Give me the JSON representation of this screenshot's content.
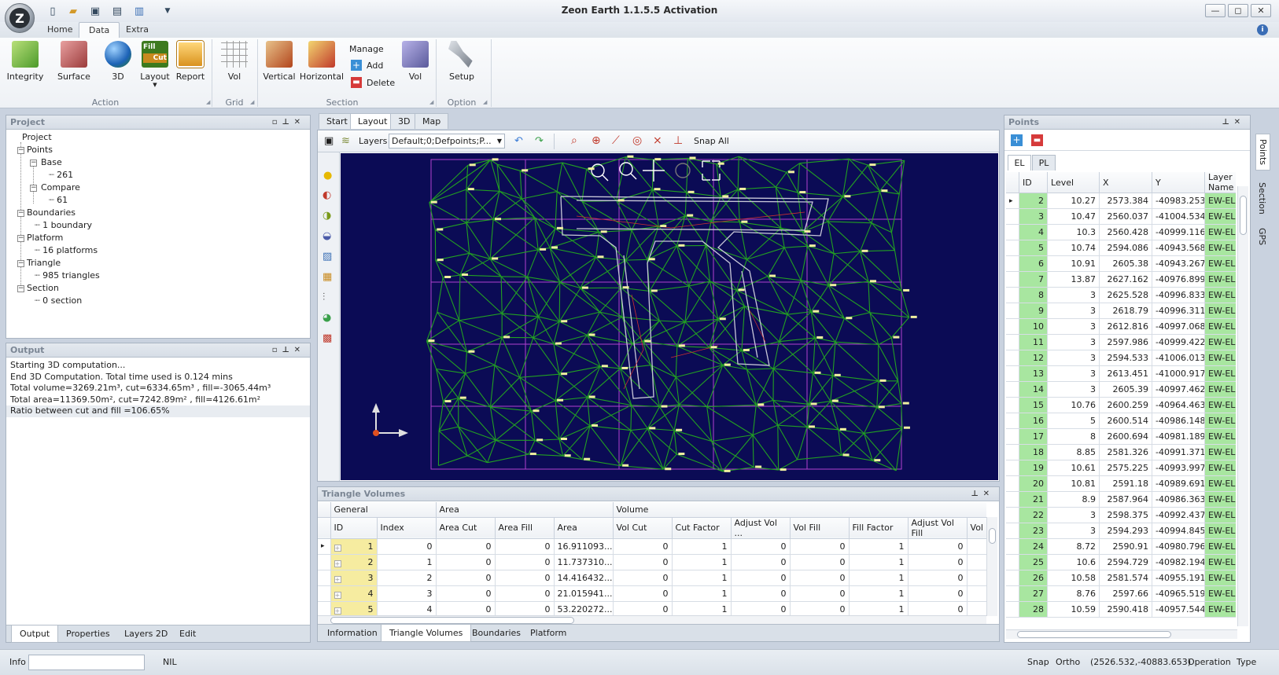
{
  "window": {
    "title": "Zeon Earth 1.1.5.5 Activation"
  },
  "ribbon": {
    "tabs": [
      "Home",
      "Data",
      "Extra"
    ],
    "groups": {
      "action": {
        "label": "Action",
        "buttons": [
          "Integrity",
          "Surface",
          "3D",
          "Layout",
          "Report"
        ],
        "fill_icon": [
          "Fill",
          "Cut"
        ]
      },
      "grid": {
        "label": "Grid",
        "buttons": [
          "Vol"
        ]
      },
      "section": {
        "label": "Section",
        "buttons": [
          "Vertical",
          "Horizontal"
        ],
        "manage": "Manage",
        "add": "Add",
        "delete": "Delete",
        "vol": "Vol"
      },
      "option": {
        "label": "Option",
        "buttons": [
          "Setup"
        ]
      }
    }
  },
  "project": {
    "title": "Project",
    "tree": {
      "root": "Project",
      "points": "Points",
      "base": "Base",
      "base_count": "261",
      "compare": "Compare",
      "compare_count": "61",
      "boundaries": "Boundaries",
      "boundaries_item": "1 boundary",
      "platform": "Platform",
      "platform_item": "16 platforms",
      "triangle": "Triangle",
      "triangle_item": "985 triangles",
      "section": "Section",
      "section_item": "0 section"
    }
  },
  "output": {
    "title": "Output",
    "lines": [
      "Starting 3D computation...",
      "End 3D Computation. Total time used is 0.124 mins",
      "Total volume=3269.21m³, cut=6334.65m³ , fill=-3065.44m³",
      "Total area=11369.50m², cut=7242.89m² , fill=4126.61m²",
      "Ratio between cut and fill =106.65%"
    ]
  },
  "left_tabs": [
    "Output",
    "Properties",
    "Layers 2D",
    "Edit"
  ],
  "doc_tabs": [
    "Start",
    "Layout",
    "3D",
    "Map"
  ],
  "layout_toolbar": {
    "layers_label": "Layers",
    "layers_value": "Default;0;Defpoints;P...",
    "snap_all": "Snap All"
  },
  "triangle_volumes": {
    "title": "Triangle Volumes",
    "band_headers": [
      "General",
      "Area",
      "Volume"
    ],
    "columns": [
      "ID",
      "Index",
      "Area Cut",
      "Area Fill",
      "Area",
      "Vol Cut",
      "Cut Factor",
      "Adjust Vol ...",
      "Vol Fill",
      "Fill Factor",
      "Adjust Vol Fill",
      "Vol"
    ],
    "rows": [
      [
        "1",
        "0",
        "0",
        "0",
        "16.911093...",
        "0",
        "1",
        "0",
        "0",
        "1",
        "0"
      ],
      [
        "2",
        "1",
        "0",
        "0",
        "11.737310...",
        "0",
        "1",
        "0",
        "0",
        "1",
        "0"
      ],
      [
        "3",
        "2",
        "0",
        "0",
        "14.416432...",
        "0",
        "1",
        "0",
        "0",
        "1",
        "0"
      ],
      [
        "4",
        "3",
        "0",
        "0",
        "21.015941...",
        "0",
        "1",
        "0",
        "0",
        "1",
        "0"
      ],
      [
        "5",
        "4",
        "0",
        "0",
        "53.220272...",
        "0",
        "1",
        "0",
        "0",
        "1",
        "0"
      ]
    ]
  },
  "bottom_tabs": [
    "Information",
    "Triangle Volumes",
    "Boundaries",
    "Platform"
  ],
  "points": {
    "title": "Points",
    "subtabs": [
      "EL",
      "PL"
    ],
    "columns": [
      "ID",
      "Level",
      "X",
      "Y",
      "Layer Name"
    ],
    "rows": [
      [
        "2",
        "10.27",
        "2573.384",
        "-40983.253",
        "EW-EL"
      ],
      [
        "3",
        "10.47",
        "2560.037",
        "-41004.534",
        "EW-EL"
      ],
      [
        "4",
        "10.3",
        "2560.428",
        "-40999.116",
        "EW-EL"
      ],
      [
        "5",
        "10.74",
        "2594.086",
        "-40943.568",
        "EW-EL"
      ],
      [
        "6",
        "10.91",
        "2605.38",
        "-40943.267",
        "EW-EL"
      ],
      [
        "7",
        "13.87",
        "2627.162",
        "-40976.899",
        "EW-EL"
      ],
      [
        "8",
        "3",
        "2625.528",
        "-40996.833",
        "EW-EL"
      ],
      [
        "9",
        "3",
        "2618.79",
        "-40996.311",
        "EW-EL"
      ],
      [
        "10",
        "3",
        "2612.816",
        "-40997.068",
        "EW-EL"
      ],
      [
        "11",
        "3",
        "2597.986",
        "-40999.422",
        "EW-EL"
      ],
      [
        "12",
        "3",
        "2594.533",
        "-41006.013",
        "EW-EL"
      ],
      [
        "13",
        "3",
        "2613.451",
        "-41000.917",
        "EW-EL"
      ],
      [
        "14",
        "3",
        "2605.39",
        "-40997.462",
        "EW-EL"
      ],
      [
        "15",
        "10.76",
        "2600.259",
        "-40964.463",
        "EW-EL"
      ],
      [
        "16",
        "5",
        "2600.514",
        "-40986.148",
        "EW-EL"
      ],
      [
        "17",
        "8",
        "2600.694",
        "-40981.189",
        "EW-EL"
      ],
      [
        "18",
        "8.85",
        "2581.326",
        "-40991.371",
        "EW-EL"
      ],
      [
        "19",
        "10.61",
        "2575.225",
        "-40993.997",
        "EW-EL"
      ],
      [
        "20",
        "10.81",
        "2591.18",
        "-40989.691",
        "EW-EL"
      ],
      [
        "21",
        "8.9",
        "2587.964",
        "-40986.363",
        "EW-EL"
      ],
      [
        "22",
        "3",
        "2598.375",
        "-40992.437",
        "EW-EL"
      ],
      [
        "23",
        "3",
        "2594.293",
        "-40994.845",
        "EW-EL"
      ],
      [
        "24",
        "8.72",
        "2590.91",
        "-40980.796",
        "EW-EL"
      ],
      [
        "25",
        "10.6",
        "2594.729",
        "-40982.194",
        "EW-EL"
      ],
      [
        "26",
        "10.58",
        "2581.574",
        "-40955.191",
        "EW-EL"
      ],
      [
        "27",
        "8.76",
        "2597.66",
        "-40965.519",
        "EW-EL"
      ],
      [
        "28",
        "10.59",
        "2590.418",
        "-40957.544",
        "EW-EL"
      ]
    ]
  },
  "side_tabs": [
    "Points",
    "Section",
    "GPS"
  ],
  "status": {
    "info_label": "Info",
    "info_value": "NIL",
    "snap": "Snap",
    "ortho": "Ortho",
    "coords": "(2526.532,-40883.653)",
    "operation": "Operation",
    "type": "Type"
  }
}
